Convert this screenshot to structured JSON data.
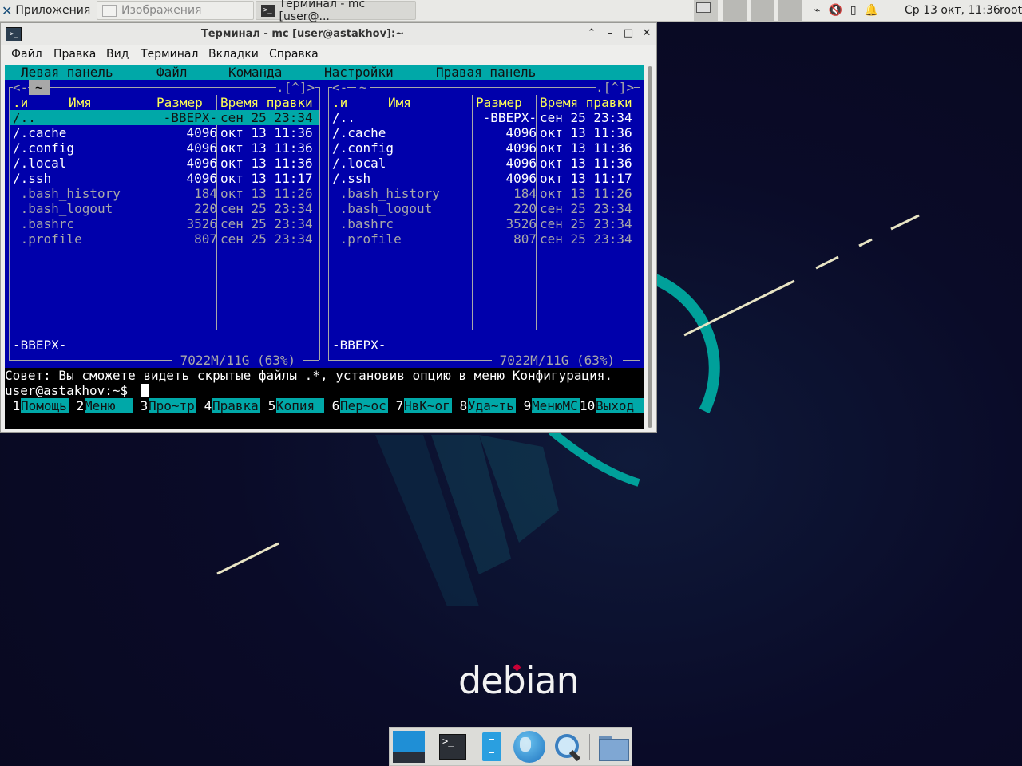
{
  "top_panel": {
    "apps_label": "Приложения",
    "task_images": "Изображения",
    "task_terminal": "Терминал - mc [user@...",
    "clock": "Ср 13 окт, 11:36",
    "user": "root"
  },
  "window": {
    "title": "Терминал - mc [user@astakhov]:~",
    "menu": [
      "Файл",
      "Правка",
      "Вид",
      "Терминал",
      "Вкладки",
      "Справка"
    ]
  },
  "mc": {
    "menubar": [
      "Левая панель",
      "Файл",
      "Команда",
      "Настройки",
      "Правая панель"
    ],
    "left_path": "~",
    "right_path": "~",
    "corner": ".[^]>",
    "headers": {
      "sort": ".и",
      "name": "Имя",
      "size": "Размер",
      "mtime": "Время правки"
    },
    "files": [
      {
        "name": "/..",
        "size": "-ВВЕРХ-",
        "mtime": "сен 25 23:34",
        "dir": true
      },
      {
        "name": "/.cache",
        "size": "4096",
        "mtime": "окт 13 11:36",
        "dir": true
      },
      {
        "name": "/.config",
        "size": "4096",
        "mtime": "окт 13 11:36",
        "dir": true
      },
      {
        "name": "/.local",
        "size": "4096",
        "mtime": "окт 13 11:36",
        "dir": true
      },
      {
        "name": "/.ssh",
        "size": "4096",
        "mtime": "окт 13 11:17",
        "dir": true
      },
      {
        "name": " .bash_history",
        "size": "184",
        "mtime": "окт 13 11:26",
        "dir": false
      },
      {
        "name": " .bash_logout",
        "size": "220",
        "mtime": "сен 25 23:34",
        "dir": false
      },
      {
        "name": " .bashrc",
        "size": "3526",
        "mtime": "сен 25 23:34",
        "dir": false
      },
      {
        "name": " .profile",
        "size": "807",
        "mtime": "сен 25 23:34",
        "dir": false
      }
    ],
    "mini_status": "-ВВЕРХ-",
    "disk_info": " 7022M/11G (63%) ",
    "hint": "Совет: Вы сможете видеть скрытые файлы .*, установив опцию в меню Конфигурация.",
    "prompt": "user@astakhov:~$ ",
    "fkeys": [
      {
        "num": " 1",
        "label": "Помощь"
      },
      {
        "num": " 2",
        "label": "Меню  "
      },
      {
        "num": " 3",
        "label": "Про~тр"
      },
      {
        "num": " 4",
        "label": "Правка"
      },
      {
        "num": " 5",
        "label": "Копия "
      },
      {
        "num": " 6",
        "label": "Пер~ос"
      },
      {
        "num": " 7",
        "label": "НвК~ог"
      },
      {
        "num": " 8",
        "label": "Уда~ть"
      },
      {
        "num": " 9",
        "label": "МенюМС"
      },
      {
        "num": "10",
        "label": "Выход "
      }
    ]
  },
  "desktop": {
    "logo_text": "debian"
  },
  "colors": {
    "mc_blue": "#0000ab",
    "mc_cyan": "#00a8a8",
    "header_yellow": "#ffff54",
    "debian_red": "#c70036"
  }
}
